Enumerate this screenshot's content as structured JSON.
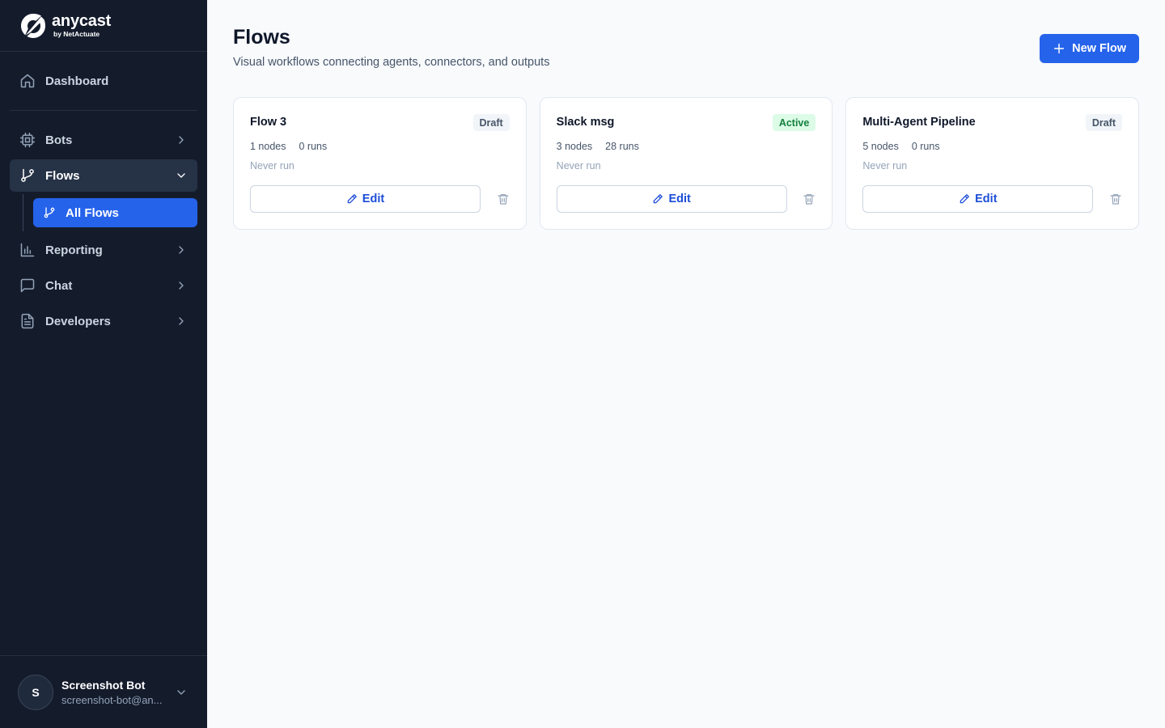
{
  "brand": {
    "name": "anycast",
    "tagline": "by NetActuate"
  },
  "sidebar": {
    "items": [
      {
        "label": "Dashboard",
        "icon": "home-icon"
      },
      {
        "label": "Bots",
        "icon": "chip-icon"
      },
      {
        "label": "Flows",
        "icon": "git-branch-icon",
        "expanded": true
      },
      {
        "label": "Reporting",
        "icon": "bar-chart-icon"
      },
      {
        "label": "Chat",
        "icon": "message-square-icon"
      },
      {
        "label": "Developers",
        "icon": "file-text-icon"
      }
    ],
    "subitems": [
      {
        "label": "All Flows",
        "icon": "git-branch-icon",
        "active": true
      }
    ]
  },
  "user": {
    "initial": "S",
    "name": "Screenshot Bot",
    "email": "screenshot-bot@an..."
  },
  "page": {
    "title": "Flows",
    "subtitle": "Visual workflows connecting agents, connectors, and outputs",
    "new_button": "New Flow"
  },
  "flows": [
    {
      "title": "Flow 3",
      "status": "Draft",
      "nodes": "1 nodes",
      "runs": "0 runs",
      "last_run": "Never run",
      "edit_label": "Edit"
    },
    {
      "title": "Slack msg",
      "status": "Active",
      "nodes": "3 nodes",
      "runs": "28 runs",
      "last_run": "Never run",
      "edit_label": "Edit"
    },
    {
      "title": "Multi-Agent Pipeline",
      "status": "Draft",
      "nodes": "5 nodes",
      "runs": "0 runs",
      "last_run": "Never run",
      "edit_label": "Edit"
    }
  ],
  "colors": {
    "sidebar_bg": "#141c2c",
    "accent": "#2563eb",
    "active_badge_bg": "#dcfce7",
    "active_badge_text": "#15803d"
  }
}
